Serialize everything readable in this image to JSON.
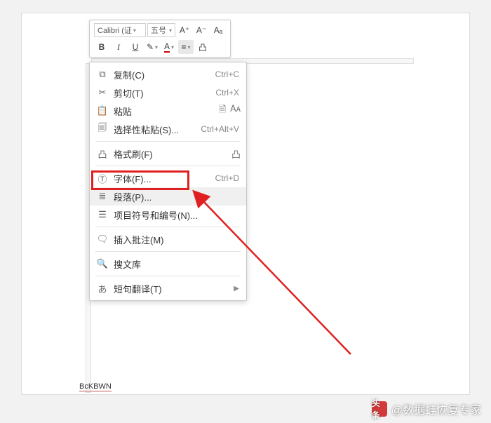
{
  "toolbar": {
    "font_name": "Calibri (证",
    "font_size": "五号",
    "increase_font": "A⁺",
    "decrease_font": "A⁻",
    "change_case": "Aₐ",
    "bold": "B",
    "italic": "I",
    "underline": "U",
    "highlight": "✎",
    "font_color": "A",
    "align": "≡",
    "format_painter": "凸"
  },
  "menu": {
    "copy": "复制(C)",
    "copy_key": "Ctrl+C",
    "cut": "剪切(T)",
    "cut_key": "Ctrl+X",
    "paste": "粘贴",
    "paste_special": "选择性粘贴(S)...",
    "paste_special_key": "Ctrl+Alt+V",
    "format_painter": "格式刷(F)",
    "font": "字体(F)...",
    "font_key": "Ctrl+D",
    "paragraph": "段落(P)...",
    "bullets": "项目符号和编号(N)...",
    "insert_comment": "插入批注(M)",
    "soutu": "搜文库",
    "short_translate": "短句翻译(T)"
  },
  "doc": {
    "text": "BcKBWN"
  },
  "watermark": {
    "prefix": "头条",
    "text": "@数据蛙恢复专家"
  }
}
